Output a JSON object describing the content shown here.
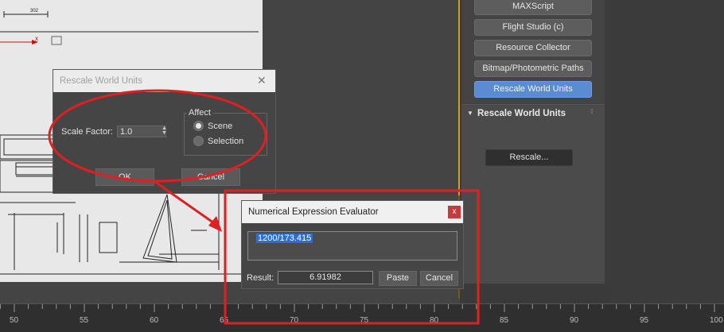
{
  "utilities": {
    "buttons": [
      "MAXScript",
      "Flight Studio (c)",
      "Resource Collector",
      "Bitmap/Photometric Paths",
      "Rescale World Units"
    ],
    "active": "Rescale World Units"
  },
  "rollout": {
    "title": "Rescale World Units",
    "rescale_button": "Rescale..."
  },
  "rescale_dialog": {
    "title": "Rescale World Units",
    "scale_factor_label": "Scale Factor:",
    "scale_factor_value": "1.0",
    "affect_label": "Affect",
    "options": [
      "Scene",
      "Selection"
    ],
    "selected_option": "Scene",
    "ok_label": "OK",
    "cancel_label": "Cancel"
  },
  "expression_evaluator": {
    "title": "Numerical Expression Evaluator",
    "close_label": "x",
    "expression": "1200/173.415",
    "result_label": "Result:",
    "result_value": "6.91982",
    "paste_label": "Paste",
    "cancel_label": "Cancel"
  },
  "timeline": {
    "labels": [
      "50",
      "55",
      "60",
      "65",
      "70",
      "75",
      "80",
      "85",
      "90",
      "95",
      "100"
    ]
  },
  "drawing": {
    "dimension_label": "302",
    "axis_label": "x"
  },
  "colors": {
    "annotation_red": "#e02020",
    "active_button": "#5b8bd0",
    "viewport_border": "#c9a227"
  }
}
